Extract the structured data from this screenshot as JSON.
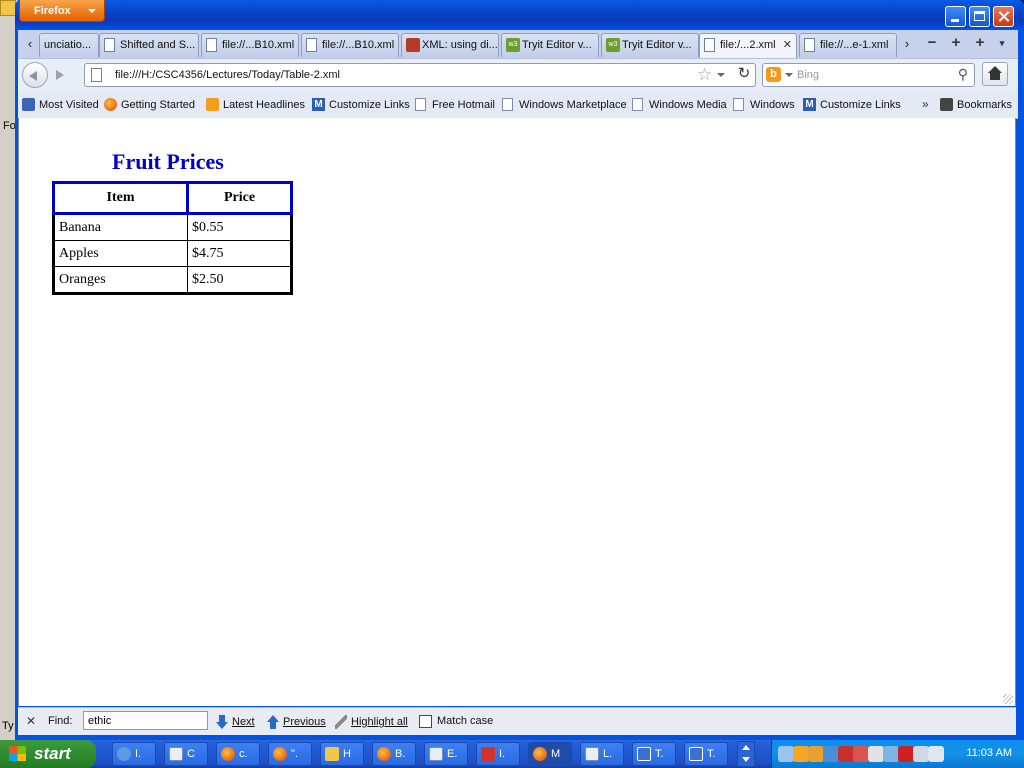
{
  "desktop": {
    "left_text_1": "Fo",
    "left_text_2": "Ty"
  },
  "window": {
    "app_button": "Firefox",
    "controls": [
      "minimize",
      "maximize",
      "close"
    ]
  },
  "tabs": [
    {
      "label": "unciatio...",
      "icon": "page-icon",
      "active": false
    },
    {
      "label": "Shifted and S...",
      "icon": "page-icon",
      "active": false
    },
    {
      "label": "file://...B10.xml",
      "icon": "page-icon",
      "active": false
    },
    {
      "label": "file://...B10.xml",
      "icon": "page-icon",
      "active": false
    },
    {
      "label": "XML: using di...",
      "icon": "xml-site-icon",
      "active": false
    },
    {
      "label": "Tryit Editor v...",
      "icon": "w3-icon",
      "active": false
    },
    {
      "label": "Tryit Editor v...",
      "icon": "w3-icon",
      "active": false
    },
    {
      "label": "file:/...2.xml",
      "icon": "page-icon",
      "active": true
    },
    {
      "label": "file://...e-1.xml",
      "icon": "page-icon",
      "active": false
    }
  ],
  "navbar": {
    "url": "file:///H:/CSC4356/Lectures/Today/Table-2.xml",
    "search_placeholder": "Bing"
  },
  "bookmarks": [
    {
      "label": "Most Visited",
      "icon": "most-visited-icon"
    },
    {
      "label": "Getting Started",
      "icon": "firefox-icon"
    },
    {
      "label": "Latest Headlines",
      "icon": "rss-icon"
    },
    {
      "label": "Customize Links",
      "icon": "msn-icon"
    },
    {
      "label": "Free Hotmail",
      "icon": "page-icon"
    },
    {
      "label": "Windows Marketplace",
      "icon": "page-icon"
    },
    {
      "label": "Windows Media",
      "icon": "page-icon"
    },
    {
      "label": "Windows",
      "icon": "page-icon"
    },
    {
      "label": "Customize Links",
      "icon": "msn-icon"
    }
  ],
  "bookmarks_overflow": "»",
  "bookmarks_menu": "Bookmarks",
  "page": {
    "title": "Fruit Prices",
    "headers": [
      "Item",
      "Price"
    ],
    "rows": [
      [
        "Banana",
        "$0.55"
      ],
      [
        "Apples",
        "$4.75"
      ],
      [
        "Oranges",
        "$2.50"
      ]
    ]
  },
  "findbar": {
    "label": "Find:",
    "value": "ethic",
    "next": "Next",
    "previous": "Previous",
    "highlight_all": "Highlight all",
    "match_case": "Match case",
    "match_case_checked": false
  },
  "taskbar": {
    "start": "start",
    "tasks": [
      {
        "label": "I.",
        "icon": "ie-icon"
      },
      {
        "label": "C",
        "icon": "document-icon"
      },
      {
        "label": "c.",
        "icon": "firefox-icon"
      },
      {
        "label": "\".",
        "icon": "firefox-icon"
      },
      {
        "label": "H",
        "icon": "folder-icon"
      },
      {
        "label": "B.",
        "icon": "firefox-icon"
      },
      {
        "label": "E.",
        "icon": "document-icon"
      },
      {
        "label": "I.",
        "icon": "red-app-icon"
      },
      {
        "label": "M",
        "icon": "firefox-icon"
      },
      {
        "label": "L.",
        "icon": "document-icon"
      },
      {
        "label": "T.",
        "icon": "blue-app-icon"
      },
      {
        "label": "T.",
        "icon": "blue-app-icon"
      }
    ],
    "active_task": 8,
    "clock": "11:03 AM",
    "tray_icons": [
      "network-icon",
      "messenger-icon",
      "alert-icon",
      "dropbox-icon",
      "security-icon",
      "antivirus-icon",
      "office-icon",
      "sync-icon",
      "red-star-icon",
      "display-icon",
      "volume-icon"
    ],
    "tray_colors": [
      "#9cc4f2",
      "#f5a623",
      "#e8a030",
      "#4a8fd6",
      "#c9302c",
      "#d9534f",
      "#e2e2e2",
      "#7fb5e6",
      "#cc2222",
      "#cfd8e6",
      "#dfe6f0"
    ]
  },
  "colors": {
    "title_blue": "#0000cc",
    "header_border": "#0000cc",
    "xp_blue": "#0054e3",
    "start_green": "#2f8d2f"
  }
}
